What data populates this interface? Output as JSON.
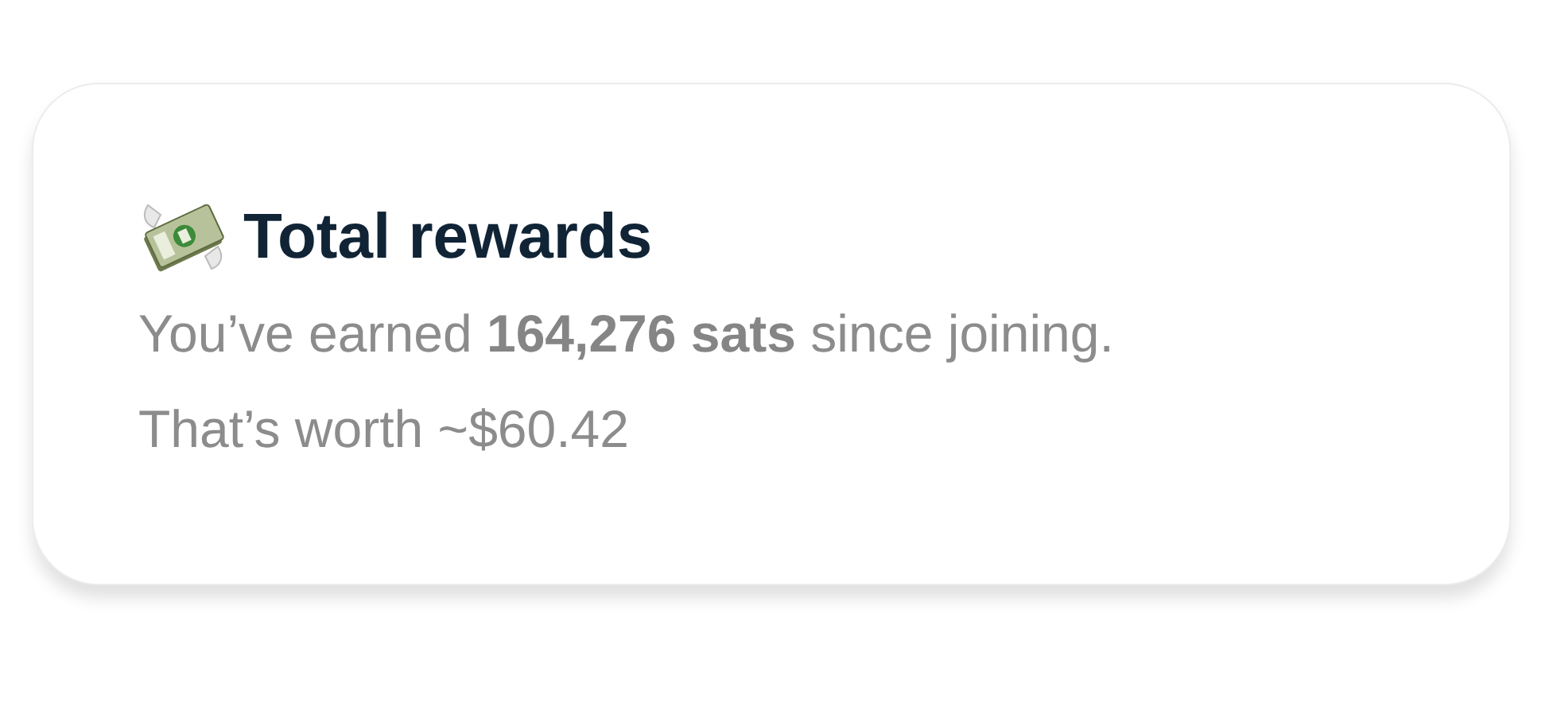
{
  "card": {
    "title": "Total rewards",
    "lines": [
      "You’ve earned **164,276 sats** since joining.",
      "That’s worth ~$60.42"
    ]
  }
}
